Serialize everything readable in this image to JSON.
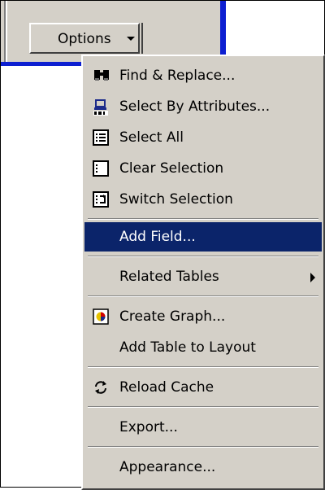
{
  "toolbar": {
    "options_label": "Options"
  },
  "menu": {
    "items": [
      {
        "label": "Find & Replace...",
        "icon": "binoculars-icon"
      },
      {
        "label": "Select By Attributes...",
        "icon": "sql-icon"
      },
      {
        "label": "Select All",
        "icon": "select-all-icon"
      },
      {
        "label": "Clear Selection",
        "icon": "clear-selection-icon"
      },
      {
        "label": "Switch Selection",
        "icon": "switch-selection-icon"
      },
      {
        "label": "Add Field...",
        "icon": ""
      },
      {
        "label": "Related Tables",
        "icon": "",
        "submenu": true
      },
      {
        "label": "Create Graph...",
        "icon": "graph-icon"
      },
      {
        "label": "Add Table to Layout",
        "icon": ""
      },
      {
        "label": "Reload Cache",
        "icon": "reload-icon"
      },
      {
        "label": "Export...",
        "icon": ""
      },
      {
        "label": "Appearance...",
        "icon": ""
      }
    ],
    "highlighted_item": "Add Field..."
  },
  "colors": {
    "menu_background": "#d4d0c8",
    "highlight": "#0b246a",
    "frame_blue": "#0d1fd1"
  }
}
